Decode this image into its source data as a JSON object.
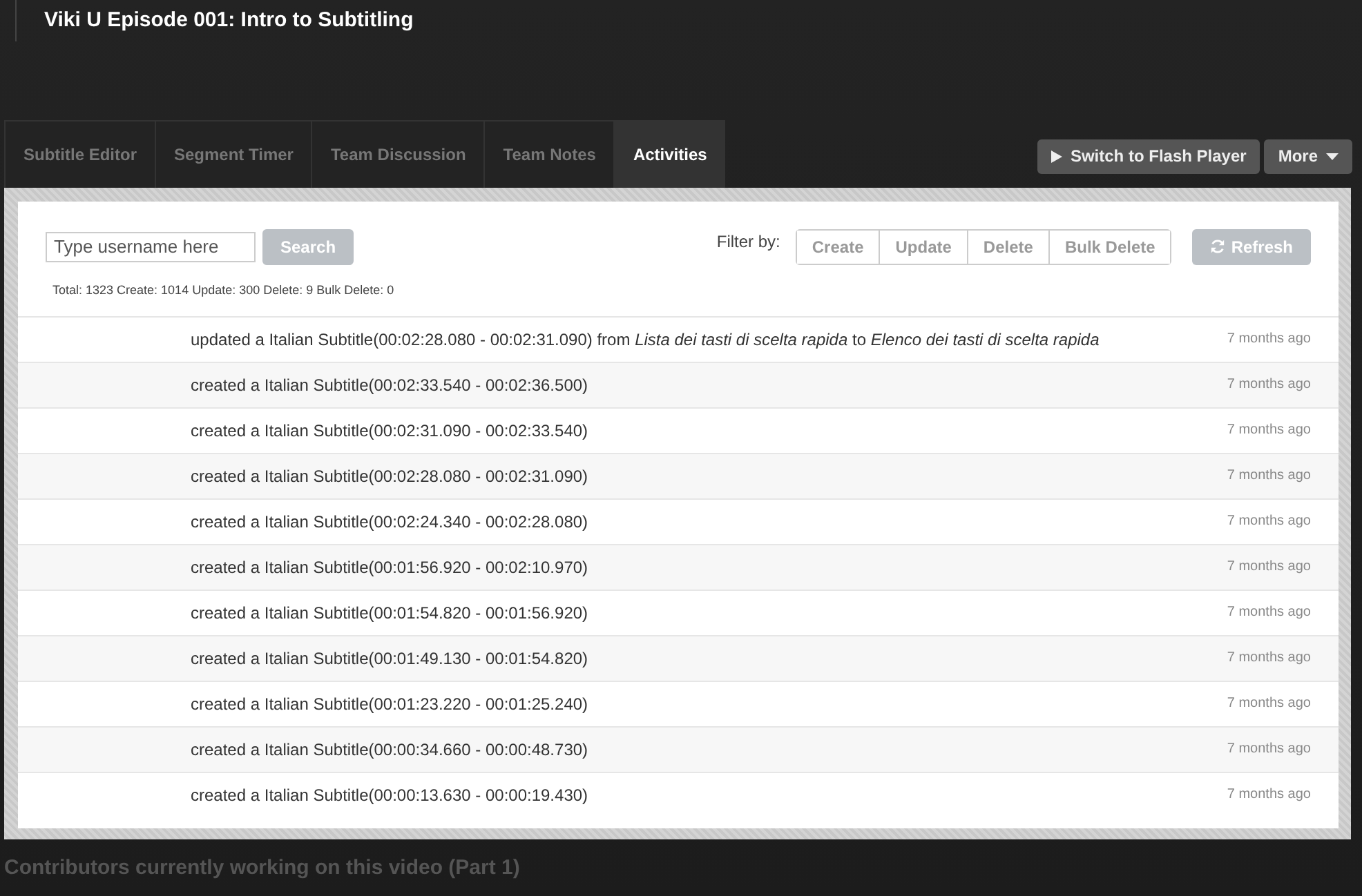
{
  "page": {
    "title": "Viki U Episode 001: Intro to Subtitling"
  },
  "tabs": [
    {
      "label": "Subtitle Editor",
      "selected": false
    },
    {
      "label": "Segment Timer",
      "selected": false
    },
    {
      "label": "Team Discussion",
      "selected": false
    },
    {
      "label": "Team Notes",
      "selected": false
    },
    {
      "label": "Activities",
      "selected": true
    }
  ],
  "header_buttons": {
    "flash": "Switch to Flash Player",
    "more": "More"
  },
  "search": {
    "placeholder": "Type username here",
    "button": "Search"
  },
  "filter": {
    "label": "Filter by:",
    "options": [
      "Create",
      "Update",
      "Delete",
      "Bulk Delete"
    ],
    "refresh": "Refresh"
  },
  "totals": "Total: 1323 Create: 1014 Update: 300 Delete: 9 Bulk Delete: 0",
  "activities": [
    {
      "text": "updated a Italian Subtitle(00:02:28.080 - 00:02:31.090) from *Lista dei tasti di scelta rapida* to *Elenco dei tasti di scelta rapida*",
      "time": "7 months ago"
    },
    {
      "text": "created a Italian Subtitle(00:02:33.540 - 00:02:36.500)",
      "time": "7 months ago"
    },
    {
      "text": "created a Italian Subtitle(00:02:31.090 - 00:02:33.540)",
      "time": "7 months ago"
    },
    {
      "text": "created a Italian Subtitle(00:02:28.080 - 00:02:31.090)",
      "time": "7 months ago"
    },
    {
      "text": "created a Italian Subtitle(00:02:24.340 - 00:02:28.080)",
      "time": "7 months ago"
    },
    {
      "text": "created a Italian Subtitle(00:01:56.920 - 00:02:10.970)",
      "time": "7 months ago"
    },
    {
      "text": "created a Italian Subtitle(00:01:54.820 - 00:01:56.920)",
      "time": "7 months ago"
    },
    {
      "text": "created a Italian Subtitle(00:01:49.130 - 00:01:54.820)",
      "time": "7 months ago"
    },
    {
      "text": "created a Italian Subtitle(00:01:23.220 - 00:01:25.240)",
      "time": "7 months ago"
    },
    {
      "text": "created a Italian Subtitle(00:00:34.660 - 00:00:48.730)",
      "time": "7 months ago"
    },
    {
      "text": "created a Italian Subtitle(00:00:13.630 - 00:00:19.430)",
      "time": "7 months ago"
    }
  ],
  "footer": "Contributors currently working on this video (Part 1)"
}
